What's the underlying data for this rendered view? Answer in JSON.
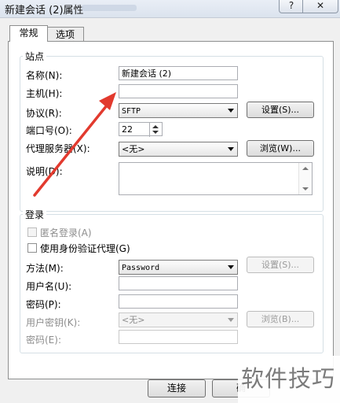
{
  "window": {
    "title": "新建会话 (2)属性",
    "help_label": "?",
    "close_label": "✕"
  },
  "tabs": [
    {
      "label": "常规"
    },
    {
      "label": "选项"
    }
  ],
  "site_group": {
    "title": "站点",
    "name_label": "名称(N):",
    "name_value": "新建会话 (2)",
    "host_label": "主机(H):",
    "host_value": "",
    "protocol_label": "协议(R):",
    "protocol_value": "SFTP",
    "settings_label": "设置(S)...",
    "port_label": "端口号(O):",
    "port_value": "22",
    "proxy_label": "代理服务器(X):",
    "proxy_value": "<无>",
    "browse_label": "浏览(W)...",
    "desc_label": "说明(D):",
    "desc_value": ""
  },
  "login_group": {
    "title": "登录",
    "anon_label": "匿名登录(A)",
    "agent_label": "使用身份验证代理(G)",
    "method_label": "方法(M):",
    "method_value": "Password",
    "method_settings_label": "设置(S)...",
    "user_label": "用户名(U):",
    "user_value": "",
    "pass_label": "密码(P):",
    "pass_value": "",
    "key_label": "用户密钥(K):",
    "key_value": "<无>",
    "key_browse_label": "浏览(B)...",
    "passphrase_label": "密码(E):",
    "passphrase_value": ""
  },
  "footer": {
    "ok_label": "连接",
    "cancel_label": "确"
  },
  "watermark": "软件技巧",
  "colors": {
    "annotation_arrow": "#e23a2e"
  }
}
